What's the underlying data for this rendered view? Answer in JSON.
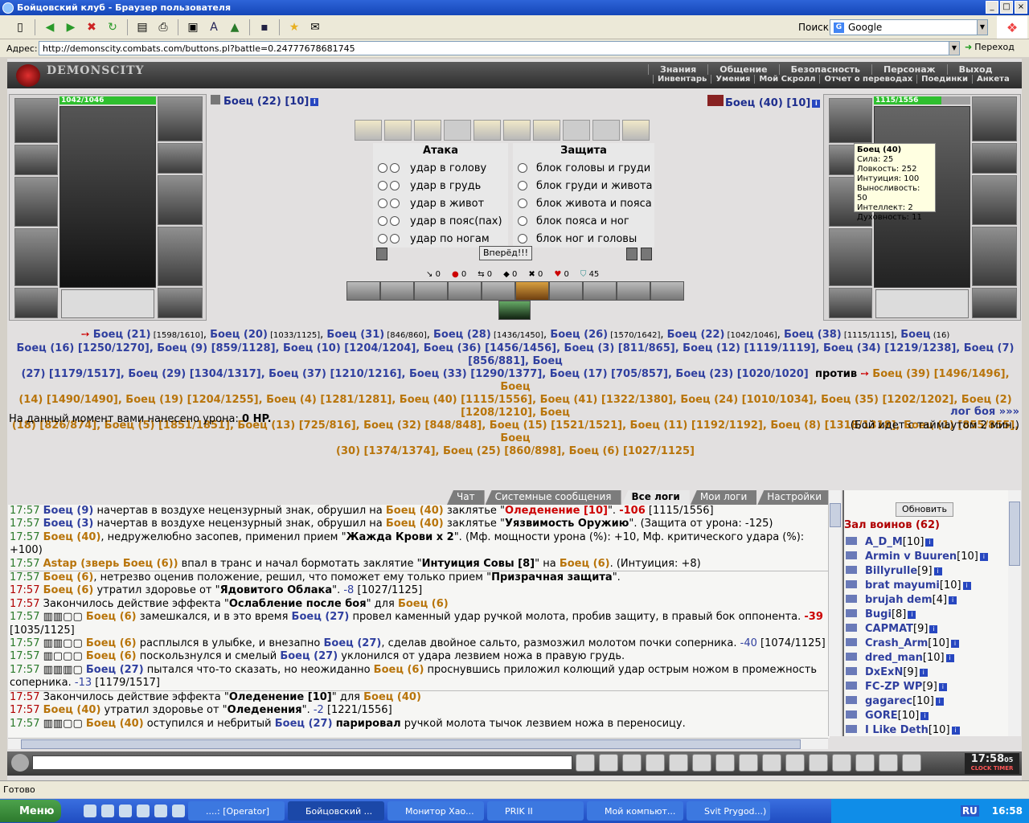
{
  "window": {
    "title": "Бойцовский клуб - Браузер пользователя"
  },
  "search": {
    "label": "Поиск:",
    "engine": "Google"
  },
  "address": {
    "label": "Адрес:",
    "url": "http://demonscity.combats.com/buttons.pl?battle=0.24777678681745",
    "go": "Переход"
  },
  "site": {
    "logo": "DEMONSCITY",
    "top_links": [
      "Знания",
      "Общение",
      "Безопасность",
      "Персонаж",
      "Выход"
    ],
    "sub_links": [
      "Инвентарь",
      "Умения",
      "Мой Скролл",
      "Отчет о переводах",
      "Поединки",
      "Анкета"
    ]
  },
  "player": {
    "name": "Боец (22)",
    "level": "[10]",
    "hp": "1042/1046"
  },
  "enemy": {
    "name": "Боец (40)",
    "level": "[10]",
    "hp": "1115/1556"
  },
  "tooltip": {
    "title": "Боец (40)",
    "lines": [
      "Сила: 25",
      "Ловкость: 252",
      "Интуиция: 100",
      "Выносливость: 50",
      "Интеллект: 2",
      "Духовность: 11"
    ]
  },
  "combat": {
    "attack_title": "Атака",
    "defense_title": "Защита",
    "attack_options": [
      "удар в голову",
      "удар в грудь",
      "удар в живот",
      "удар в пояс(пах)",
      "удар по ногам"
    ],
    "defense_options": [
      "блок головы и груди",
      "блок груди и живота",
      "блок живота и пояса",
      "блок пояса и ног",
      "блок ног и головы"
    ],
    "forward_button": "Вперёд!!!",
    "stats": [
      "0",
      "0",
      "0",
      "0",
      "0",
      "0",
      "45"
    ]
  },
  "teams": {
    "line1": [
      [
        "Боец (21)",
        "[1598/1610]"
      ],
      [
        "Боец (20)",
        "[1033/1125]"
      ],
      [
        "Боец (31)",
        "[846/860]"
      ],
      [
        "Боец (28)",
        "[1436/1450]"
      ],
      [
        "Боец (26)",
        "[1570/1642]"
      ],
      [
        "Боец (22)",
        "[1042/1046]"
      ],
      [
        "Боец (38)",
        "[1115/1115]"
      ],
      [
        "Боец",
        "(16)"
      ]
    ],
    "left_text_2": "Боец (16) [1250/1270], Боец (9) [859/1128], Боец (10) [1204/1204], Боец (36) [1456/1456], Боец (3) [811/865], Боец (12) [1119/1119], Боец (34) [1219/1238], Боец (7) [856/881], Боец",
    "left_text_3": "(27) [1179/1517], Боец (29) [1304/1317], Боец (37) [1210/1216], Боец (33) [1290/1377], Боец (17) [705/857], Боец (23) [1020/1020]",
    "versus": "против",
    "right_text_3": "Боец (39) [1496/1496], Боец",
    "right_text_4": "(14) [1490/1490], Боец (19) [1204/1255], Боец (4) [1281/1281], Боец (40) [1115/1556], Боец (41) [1322/1380], Боец (24) [1010/1034], Боец (35) [1202/1202], Боец (2) [1208/1210], Боец",
    "right_text_5": "(18) [826/874], Боец (5) [1851/1851], Боец (13) [725/816], Боец (32) [848/848], Боец (15) [1521/1521], Боец (11) [1192/1192], Боец (8) [1318/1318], Боец (1) [855/855], Боец",
    "right_text_6": "(30) [1374/1374], Боец (25) [860/898], Боец (6) [1027/1125]"
  },
  "damage": {
    "text": "На данный момент вами нанесено урона:",
    "value": "0 HP."
  },
  "battle_log_link": "лог боя »»»",
  "timeout_text": "(Бой идет с таймаутом 2 мин.)",
  "chat_tabs": [
    "Чат",
    "Системные сообщения",
    "Все логи",
    "Мои логи",
    "Настройки"
  ],
  "log": [
    {
      "time": "17:57",
      "html": "<span class='a'>Боец (9)</span> начертав в воздухе нецензурный знак, обрушил на <span class='b'>Боец (40)</span> заклятье \"<span class='m'>Оледенение [10]</span>\". <span class='m'>-106</span> [1115/1556]"
    },
    {
      "time": "17:57",
      "html": "<span class='a'>Боец (3)</span> начертав в воздухе нецензурный знак, обрушил на <span class='b'>Боец (40)</span> заклятье \"<b>Уязвимость Оружию</b>\". (Защита от урона: -125)"
    },
    {
      "time": "17:57",
      "html": "<span class='b'>Боец (40)</span>, недружелюбно засопев, применил прием \"<b>Жажда Крови x 2</b>\". (Мф. мощности урона (%): +10, Мф. критического удара (%): +100)"
    },
    {
      "time": "17:57",
      "html": "<span class='b'>Astap (зверь Боец (6))</span> впал в транс и начал бормотать заклятие \"<b>Интуиция Совы [8]</b>\" на <span class='b'>Боец (6)</span>. (Интуиция: +8)"
    },
    {
      "time": "17:57",
      "html": "<span class='b'>Боец (6)</span>, нетрезво оценив положение, решил, что поможет ему только прием \"<b>Призрачная защита</b>\".",
      "sep": true
    },
    {
      "time": "17:57",
      "html": "<span class='b'>Боец (6)</span> утратил здоровье от \"<b>Ядовитого Облака</b>\". <span class='d'>-8</span> [1027/1125]",
      "red": true
    },
    {
      "time": "17:57",
      "html": "Закончилось действие эффекта \"<b>Ослабление после боя</b>\" для <span class='b'>Боец (6)</span>",
      "red": true
    },
    {
      "time": "17:57",
      "html": "▥▥▢▢ <span class='b'>Боец (6)</span> замешкался, и в это время <span class='a'>Боец (27)</span> провел каменный удар ручкой молота, пробив защиту, в правый бок оппонента. <span class='m'>-39</span> [1035/1125]"
    },
    {
      "time": "17:57",
      "html": "▥▥▢▢ <span class='b'>Боец (6)</span> расплылся в улыбке, и внезапно <span class='a'>Боец (27)</span>, сделав двойное сальто, размозжил молотом почки соперника. <span class='d'>-40</span> [1074/1125]"
    },
    {
      "time": "17:57",
      "html": "▥▢▢▢ <span class='b'>Боец (6)</span> поскользнулся и смелый <span class='a'>Боец (27)</span> уклонился от удара лезвием ножа в правую грудь."
    },
    {
      "time": "17:57",
      "html": "▥▥▥▢ <span class='a'>Боец (27)</span> пытался что-то сказать, но неожиданно <span class='b'>Боец (6)</span> проснувшись приложил колющий удар острым ножом в промежность соперника. <span class='d'>-13</span> [1179/1517]"
    },
    {
      "time": "17:57",
      "html": "Закончилось действие эффекта \"<b>Оледенение [10]</b>\" для <span class='b'>Боец (40)</span>",
      "red": true,
      "sep": true
    },
    {
      "time": "17:57",
      "html": "<span class='b'>Боец (40)</span> утратил здоровье от \"<b>Оледенения</b>\". <span class='d'>-2</span> [1221/1556]",
      "red": true
    },
    {
      "time": "17:57",
      "html": "▥▥▢▢ <span class='b'>Боец (40)</span> оступился и небритый <span class='a'>Боец (27)</span> <b>парировал</b> ручкой молота тычок лезвием ножа в переносицу."
    }
  ],
  "users_panel": {
    "refresh": "Обновить",
    "hall_title": "Зал воинов (62)",
    "users": [
      {
        "name": "A_D_M",
        "lvl": "[10]"
      },
      {
        "name": "Armin v Buuren",
        "lvl": "[10]"
      },
      {
        "name": "Billyrulle",
        "lvl": "[9]"
      },
      {
        "name": "brat mayumi",
        "lvl": "[10]"
      },
      {
        "name": "brujah dem",
        "lvl": "[4]"
      },
      {
        "name": "Bugi",
        "lvl": "[8]"
      },
      {
        "name": "CAPMAT",
        "lvl": "[9]"
      },
      {
        "name": "Crash_Arm",
        "lvl": "[10]"
      },
      {
        "name": "dred_man",
        "lvl": "[10]"
      },
      {
        "name": "DxExN",
        "lvl": "[9]"
      },
      {
        "name": "FC-ZP WP",
        "lvl": "[9]"
      },
      {
        "name": "gagarec",
        "lvl": "[10]"
      },
      {
        "name": "GORE",
        "lvl": "[10]"
      },
      {
        "name": "I Like Deth",
        "lvl": "[10]"
      }
    ]
  },
  "clock": {
    "time": "17:58",
    "sec": "05",
    "label": "CLOCK TIMER"
  },
  "statusbar": {
    "text": "Готово"
  },
  "taskbar": {
    "start": "Меню",
    "tasks": [
      "....: [Operator]",
      "Бойцовский ...",
      "Монитор Хао...",
      "PRIK II",
      "Мой компьют...",
      "Svit Prygod...)"
    ],
    "lang": "RU",
    "time": "16:58"
  }
}
